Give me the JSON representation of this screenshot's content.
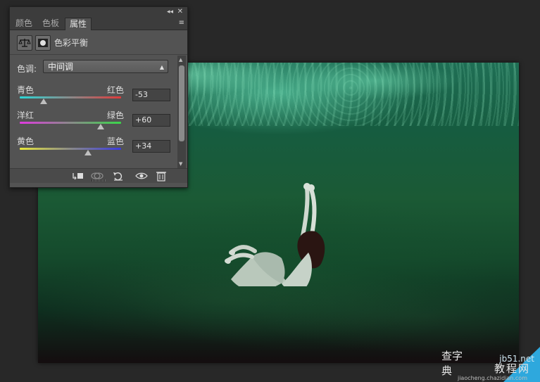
{
  "panel": {
    "tabs": [
      {
        "label": "颜色",
        "active": false
      },
      {
        "label": "色板",
        "active": false
      },
      {
        "label": "属性",
        "active": true
      }
    ],
    "header_title": "色彩平衡",
    "tone": {
      "label": "色调:",
      "value": "中间调"
    },
    "sliders": [
      {
        "left": "青色",
        "right": "红色",
        "value": "-53",
        "track_colors": [
          "#2bd6d6",
          "#e03a3a"
        ],
        "position_percent": 23.5
      },
      {
        "left": "洋红",
        "right": "绿色",
        "value": "+60",
        "track_colors": [
          "#e03ae0",
          "#3ad64a"
        ],
        "position_percent": 80
      },
      {
        "left": "黄色",
        "right": "蓝色",
        "value": "+34",
        "track_colors": [
          "#e8e83a",
          "#3a3ae0"
        ],
        "position_percent": 67
      }
    ],
    "icons": {
      "topbar": [
        "collapse-icon",
        "close-icon",
        "panel-menu-icon"
      ],
      "header": [
        "balance-scale-icon",
        "layer-mask-icon"
      ],
      "bottom": [
        "clip-to-layer-icon",
        "view-previous-state-icon",
        "reset-icon",
        "visibility-eye-icon",
        "delete-trash-icon"
      ]
    }
  },
  "watermark": {
    "line1": "jb51.net",
    "line2": "教程网",
    "line3": "jiaocheng.chazidian.com",
    "seal": "查字典"
  },
  "colors": {
    "workspace_bg": "#282828",
    "panel_bg": "#535353",
    "watermark_blue": "#2ea8dd"
  }
}
